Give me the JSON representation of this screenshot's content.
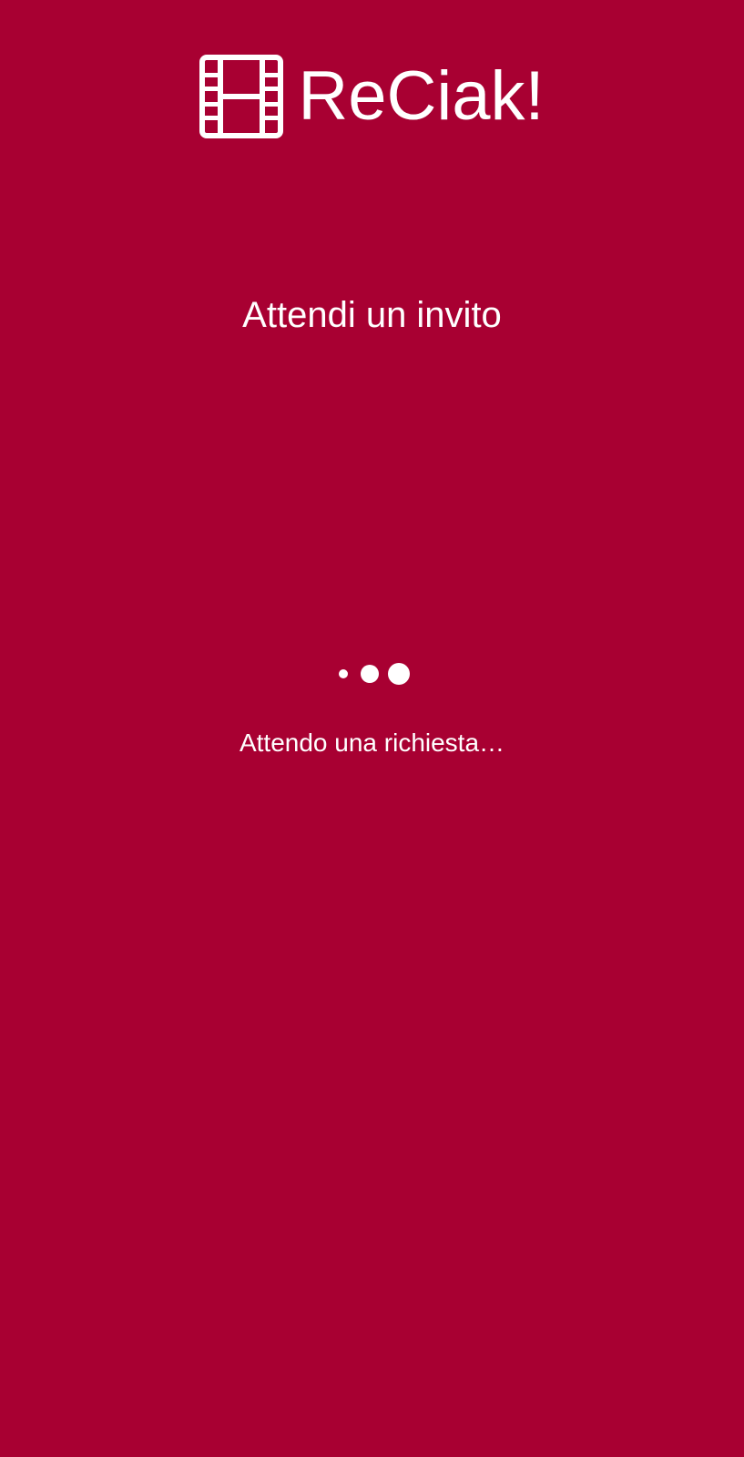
{
  "app": {
    "title": "ReCiak!",
    "logo_icon": "film-strip-icon",
    "background_color": "#a80032",
    "foreground_color": "#ffffff"
  },
  "main": {
    "heading": "Attendi un invito",
    "loader_icon": "loading-dots-icon",
    "status": "Attendo una richiesta…"
  }
}
